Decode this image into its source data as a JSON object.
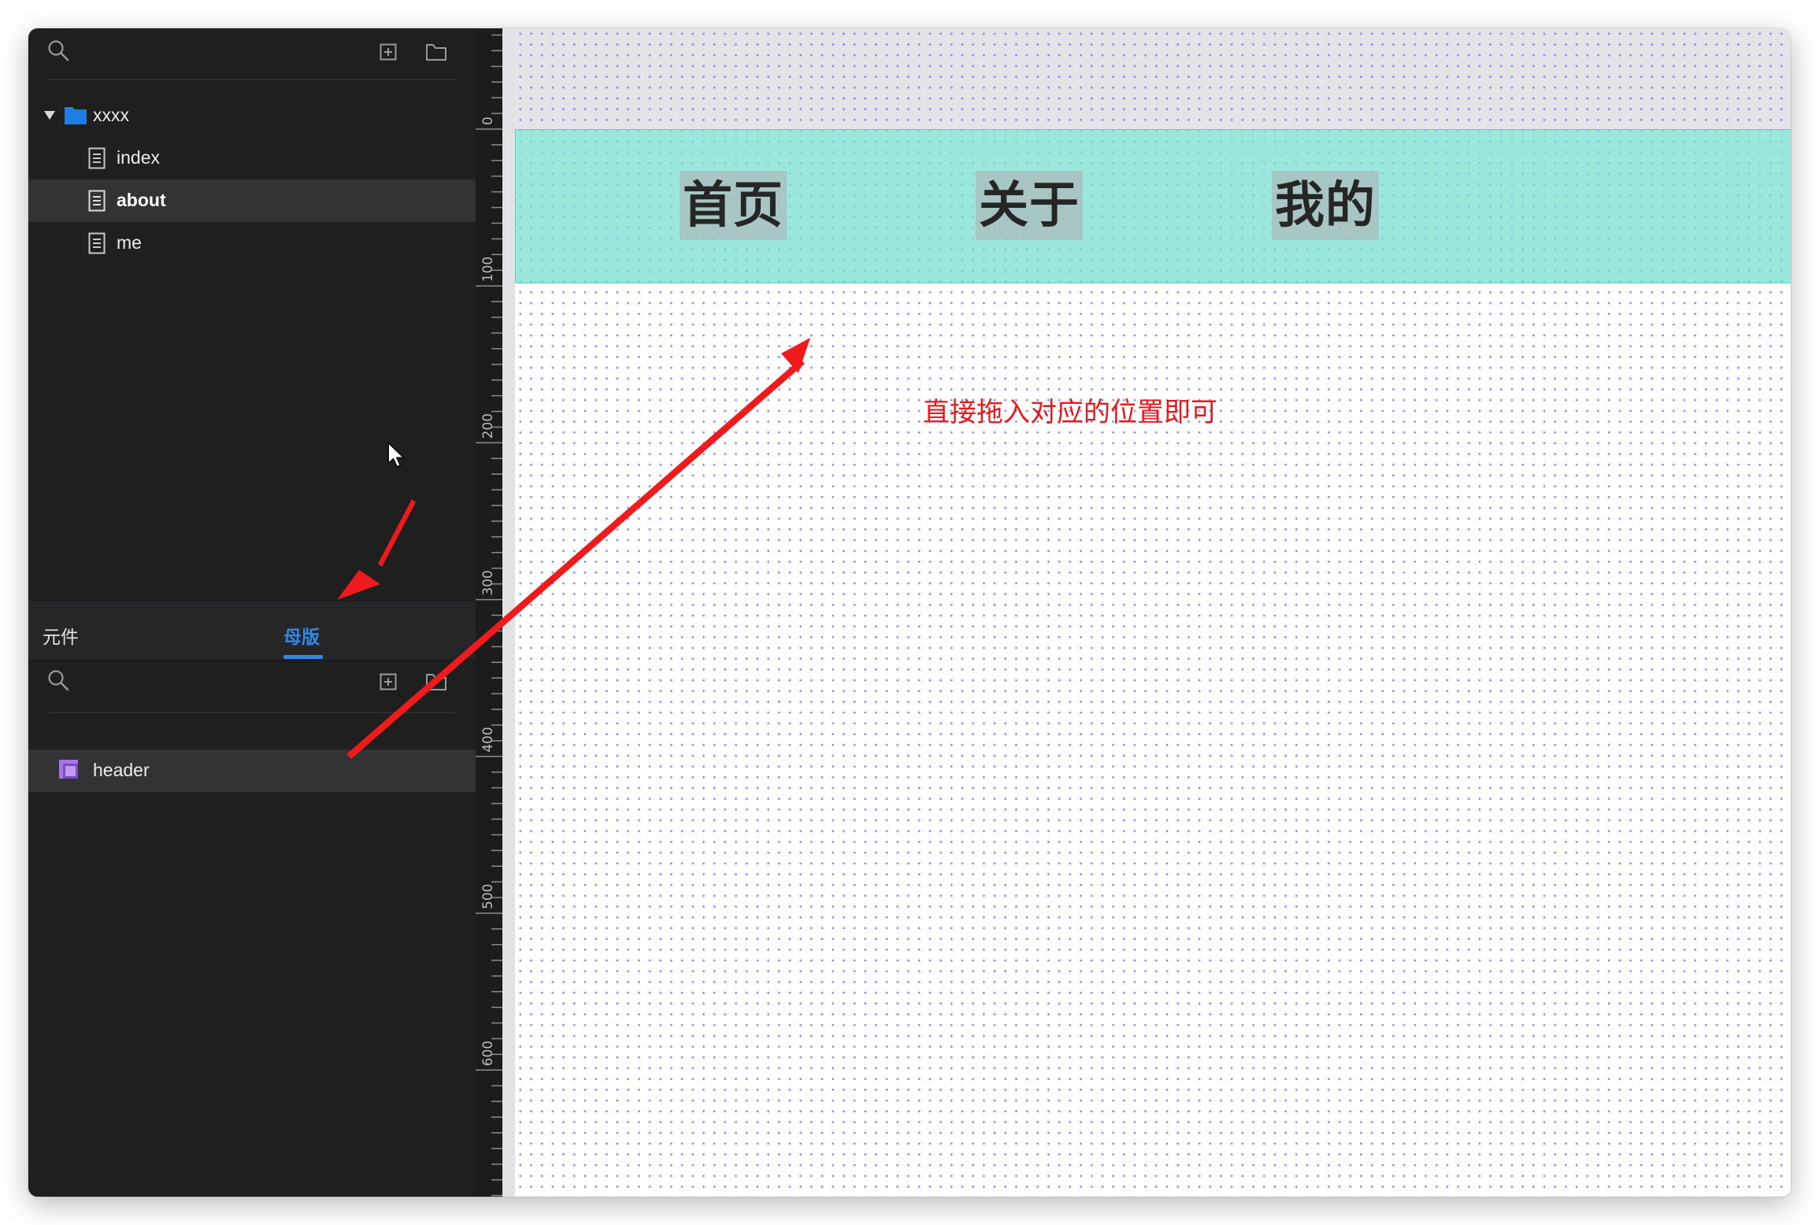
{
  "sidebar": {
    "pages_tree": {
      "folder": {
        "label": "xxxx",
        "color": "#1e7fe0"
      },
      "items": [
        {
          "label": "index",
          "selected": false
        },
        {
          "label": "about",
          "selected": true
        },
        {
          "label": "me",
          "selected": false
        }
      ]
    },
    "tabs": [
      {
        "label": "元件",
        "active": false
      },
      {
        "label": "母版",
        "active": true
      }
    ],
    "masters": [
      {
        "label": "header",
        "icon": "master-icon"
      }
    ]
  },
  "ruler": {
    "labels": [
      "0",
      "100",
      "200",
      "300",
      "400",
      "500",
      "600"
    ]
  },
  "canvas": {
    "nav": [
      "首页",
      "关于",
      "我的"
    ],
    "annotation": "直接拖入对应的位置即可"
  },
  "colors": {
    "accent": "#2f88e6",
    "annotation_red": "#e8191c",
    "header_fill": "#78ded0",
    "sidebar_bg": "#1f1f20"
  }
}
